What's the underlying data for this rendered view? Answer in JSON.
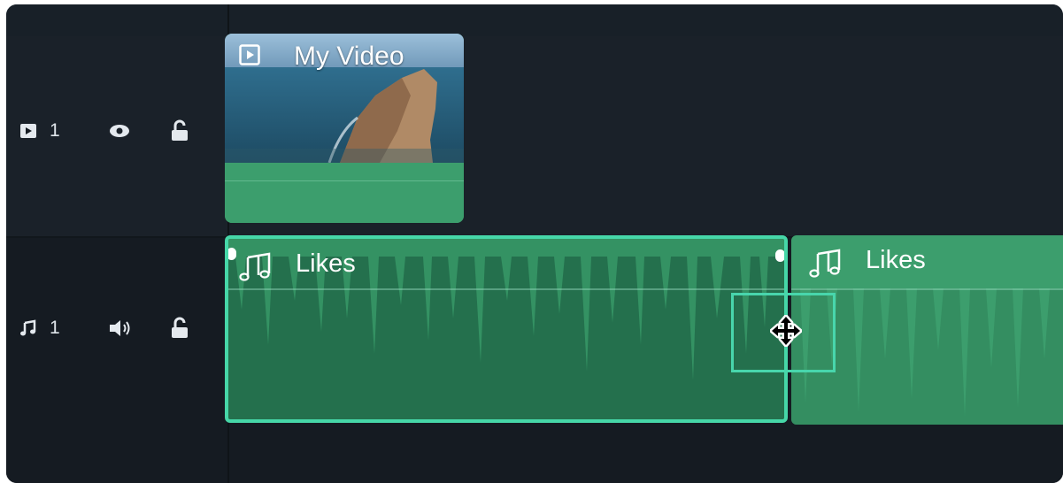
{
  "tracks": {
    "video": {
      "number": "1",
      "type_icon": "video-track-icon",
      "visibility_icon": "eye-icon",
      "lock_icon": "lock-open-icon"
    },
    "audio": {
      "number": "1",
      "type_icon": "music-note-icon",
      "volume_icon": "speaker-icon",
      "lock_icon": "lock-open-icon"
    }
  },
  "clips": {
    "video": {
      "title": "My Video",
      "icon": "play-box-icon"
    },
    "audio": [
      {
        "title": "Likes",
        "icon": "music-notes-icon",
        "selected": true
      },
      {
        "title": "Likes",
        "icon": "music-notes-icon",
        "selected": false
      }
    ]
  },
  "cursor": {
    "type": "move-cursor-icon"
  },
  "colors": {
    "background": "#151b22",
    "clip_green": "#3c9e6d",
    "selected_clip": "#24704d",
    "selection_border": "#46d7a8"
  }
}
